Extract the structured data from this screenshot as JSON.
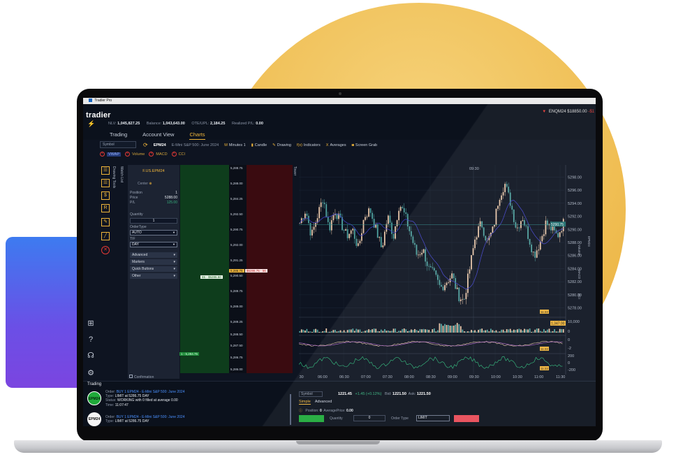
{
  "app": {
    "window_title": "Tradier Pro",
    "logo_text": "tradier"
  },
  "colors": {
    "accent": "#f0b53a",
    "bid_green": "#0e3d1c",
    "ask_red": "#3a0b10",
    "background": "#0e1421",
    "up_candle": "#e9c7a9",
    "down_candle": "#4fa3a0"
  },
  "header": {
    "ticker": {
      "arrow": "▼",
      "symbol": "ENQM24",
      "price": "$18850.00",
      "change": "-$1"
    },
    "stats": [
      {
        "label": "NLV:",
        "value": "1,045,827.25"
      },
      {
        "label": "Balance:",
        "value": "1,043,643.00"
      },
      {
        "label": "OTE/UPL:",
        "value": "2,184.25"
      },
      {
        "label": "Realized P/L:",
        "value": "0.00"
      }
    ],
    "tabs": [
      "Trading",
      "Account View",
      "Charts"
    ],
    "active_tab": "Charts"
  },
  "toolbar": {
    "symbol_placeholder": "Symbol",
    "symbol": "EPM24",
    "description": "E-Mini S&P 500: June 2024",
    "interval": "Minutes 1",
    "items": [
      "Candle",
      "Drawing",
      "Indicators",
      "Averages",
      "Screen Grab"
    ]
  },
  "indicators": [
    "VWAP",
    "Volume",
    "MACD",
    "CCI"
  ],
  "side_labels": {
    "watch_list": "Watch List",
    "drawing_tools": "Drawing Tools",
    "tower": "Tower"
  },
  "dom": {
    "header": "F.US.EPM24",
    "center_label": "Center",
    "position_label": "Position",
    "position_value": "1",
    "price_label": "Price",
    "price_value": "5288.00",
    "pl_label": "P/L",
    "pl_value": "125.00",
    "quantity_label": "Quantity",
    "quantity_value": "1",
    "order_type_label": "OrderType",
    "order_type_value": "AUTO",
    "tif_label": "TIF",
    "tif_value": "DAY",
    "sections": [
      "Advanced",
      "Markers",
      "Quick Buttons",
      "Other"
    ],
    "prices": [
      "5,288.75",
      "5,288.00",
      "5,284.25",
      "5,292.50",
      "5,290.75",
      "5,292.00",
      "5,291.25",
      "5,290.50",
      "5,289.75",
      "5,289.00",
      "5,289.25",
      "5,288.50",
      "5,287.50",
      "5,286.75",
      "5,286.00"
    ],
    "bid_tag": "65 - $5286.50",
    "ask_tag": "$5286.75 - 56",
    "last_tag": "5,286.75",
    "green_tag": "1 - 5,284.75",
    "confirmation": "Confirmation"
  },
  "chart_data": {
    "type": "candlestick",
    "title": "",
    "x_ticks": [
      "5:30",
      "06:00",
      "06:30",
      "07:00",
      "07:30",
      "08:00",
      "08:30",
      "09:00",
      "09:30",
      "10:00",
      "10:30",
      "11:00",
      "11:30"
    ],
    "top_marker": "09:30",
    "y_ticks": [
      5298.0,
      5296.0,
      5294.0,
      5292.0,
      5290.0,
      5288.0,
      5286.0,
      5284.0,
      5282.0,
      5280.0,
      5278.0
    ],
    "y_labels": [
      "5298.00",
      "5296.00",
      "5294.00",
      "5292.00",
      "5290.00",
      "5288.00",
      "5286.00",
      "5284.00",
      "5282.00",
      "5280.00",
      "5278.00"
    ],
    "ylim": [
      5277,
      5299
    ],
    "current_price_tag": "5290.75",
    "panel_axis_label": "EPM24",
    "volume_panel": {
      "label": "Volume",
      "ticks": [
        "10,000",
        "0"
      ],
      "tag": "1,347.00"
    },
    "macd_panel": {
      "label": "MACD",
      "ticks": [
        "0",
        "-2"
      ]
    },
    "cci_panel": {
      "label": "CCI",
      "ticks": [
        "200",
        "0",
        "-200"
      ]
    },
    "small_tags": [
      "11:22",
      "11:22",
      "11:22"
    ],
    "close_path": [
      5291,
      5293,
      5289,
      5292,
      5295,
      5290,
      5293,
      5291,
      5289,
      5290,
      5287,
      5292,
      5293,
      5290,
      5287,
      5292,
      5289,
      5294,
      5292,
      5289,
      5286,
      5287,
      5284,
      5283,
      5281,
      5282,
      5283,
      5280,
      5279,
      5284,
      5289,
      5291,
      5288,
      5290,
      5295,
      5297,
      5294,
      5290,
      5292,
      5289,
      5286,
      5288,
      5291,
      5290,
      5289,
      5291
    ]
  },
  "trading": {
    "title": "Trading",
    "orders": [
      {
        "badge": "EPM24",
        "order": "BUY 1 EPM24 - E-Mini S&P 500: June 2024",
        "type": "LIMIT at 5286.75 DAY",
        "status": "WORKING with 0 filled at average 0.00",
        "time": "11:07:47"
      },
      {
        "badge": "EPM24",
        "order": "BUY 1 EPM24 - E-Mini S&P 500: June 2024",
        "type": "LIMIT at 5286.75 DAY"
      }
    ],
    "labels": {
      "order": "Order:",
      "type": "Type:",
      "status": "Status:",
      "time": "Time:"
    }
  },
  "ticket": {
    "symbol_placeholder": "Symbol",
    "price": "1221.45",
    "change": "+1.45 (+0.12%)",
    "bid_label": "Bid:",
    "bid": "1221.50",
    "ask_label": "Ask:",
    "ask": "1221.50",
    "tabs": [
      "Simple",
      "Advanced"
    ],
    "position_label": "Position:",
    "position": "0",
    "avg_label": "AveragePrice:",
    "avg": "0.00",
    "quantity_label": "Quantity",
    "quantity": "0",
    "order_type_label": "Order Type",
    "order_type": "LIMIT"
  }
}
